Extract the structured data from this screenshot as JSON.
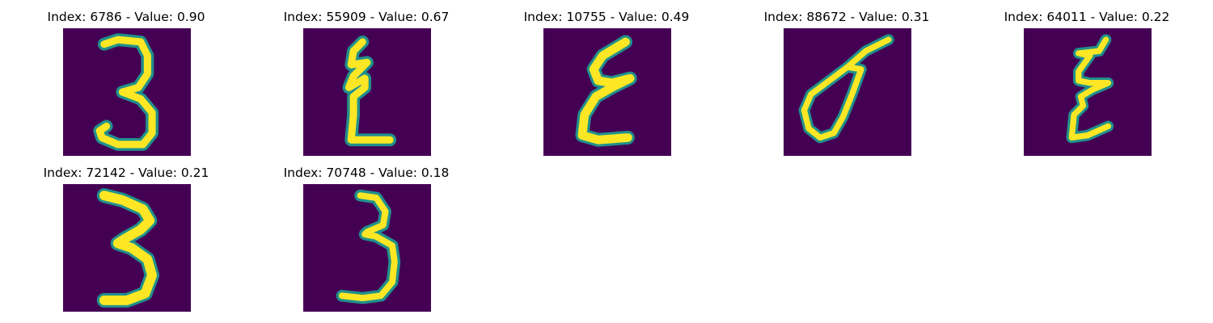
{
  "colors": {
    "background": "#440154",
    "stroke_outer": "#21918c",
    "stroke_inner": "#fde725",
    "stroke_mid": "#5ec962"
  },
  "panels": [
    {
      "title": "Index: 6786 - Value: 0.90",
      "index": 6786,
      "value": 0.9,
      "digit": "3"
    },
    {
      "title": "Index: 55909 - Value: 0.67",
      "index": 55909,
      "value": 0.67,
      "digit": "zigzag-L"
    },
    {
      "title": "Index: 10755 - Value: 0.49",
      "index": 10755,
      "value": 0.49,
      "digit": "zigzag-E"
    },
    {
      "title": "Index: 88672 - Value: 0.31",
      "index": 88672,
      "value": 0.31,
      "digit": "loop-8"
    },
    {
      "title": "Index: 64011 - Value: 0.22",
      "index": 64011,
      "value": 0.22,
      "digit": "zigzag-E-thin"
    },
    {
      "title": "Index: 72142 - Value: 0.21",
      "index": 72142,
      "value": 0.21,
      "digit": "3-bold"
    },
    {
      "title": "Index: 70748 - Value: 0.18",
      "index": 70748,
      "value": 0.18,
      "digit": "3-thin"
    }
  ]
}
